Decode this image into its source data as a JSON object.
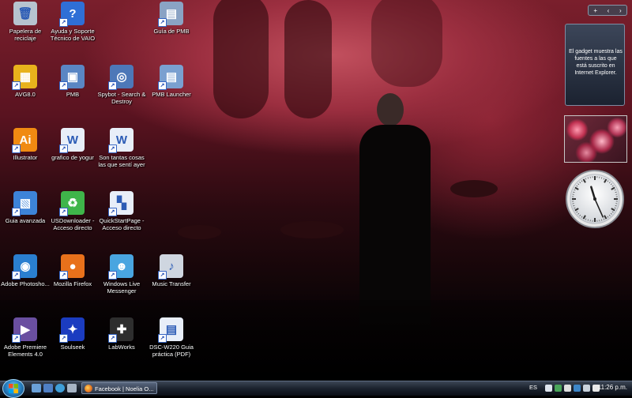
{
  "desktop": {
    "icons": [
      {
        "label": "Papelera de reciclaje",
        "icon": "recycle-bin-icon",
        "color": "#b7c3cf",
        "glyph": "🗑"
      },
      {
        "label": "Ayuda y Soporte Técnico de VAIO",
        "icon": "help-icon",
        "color": "#2f6fd6",
        "glyph": "?"
      },
      {
        "label": "Guía de PMB",
        "icon": "pmb-guide-icon",
        "color": "#8aa3c4",
        "glyph": "▤"
      },
      {
        "label": "AVG8.0",
        "icon": "avg-icon",
        "color": "#e8b21c",
        "glyph": "▦"
      },
      {
        "label": "PMB",
        "icon": "pmb-icon",
        "color": "#5a86c4",
        "glyph": "▣"
      },
      {
        "label": "Spybot - Search & Destroy",
        "icon": "spybot-icon",
        "color": "#4d78b8",
        "glyph": "◎"
      },
      {
        "label": "PMB Launcher",
        "icon": "pmb-launcher-icon",
        "color": "#7aa0d0",
        "glyph": "▤"
      },
      {
        "label": "Illustrator",
        "icon": "illustrator-icon",
        "color": "#f08a12",
        "glyph": "Ai"
      },
      {
        "label": "grafico de yogur",
        "icon": "word-document-icon",
        "color": "#e8eef8",
        "glyph": "W"
      },
      {
        "label": "Son tantas cosas las que sentí ayer",
        "icon": "word-document-icon",
        "color": "#e8eef8",
        "glyph": "W"
      },
      {
        "label": "Guia avanzada",
        "icon": "guide-icon",
        "color": "#3d83d8",
        "glyph": "▧"
      },
      {
        "label": "USDownloader - Acceso directo",
        "icon": "usdownloader-icon",
        "color": "#3fb54a",
        "glyph": "♻"
      },
      {
        "label": "QuickStartPage - Acceso directo",
        "icon": "quickstartpage-icon",
        "color": "#e8eef8",
        "glyph": "▚"
      },
      {
        "label": "Adobe Photosho...",
        "icon": "photoshop-icon",
        "color": "#2a7fd0",
        "glyph": "◉"
      },
      {
        "label": "Mozilla Firefox",
        "icon": "firefox-icon",
        "color": "#e8711b",
        "glyph": "●"
      },
      {
        "label": "Windows Live Messenger",
        "icon": "messenger-icon",
        "color": "#49a5e0",
        "glyph": "☻"
      },
      {
        "label": "Music Transfer",
        "icon": "music-transfer-icon",
        "color": "#cfd6e0",
        "glyph": "♪"
      },
      {
        "label": "Adobe Premiere Elements 4.0",
        "icon": "premiere-icon",
        "color": "#6a4fa0",
        "glyph": "▶"
      },
      {
        "label": "Soulseek",
        "icon": "soulseek-icon",
        "color": "#1b3cc0",
        "glyph": "✦"
      },
      {
        "label": "LabWorks",
        "icon": "labworks-icon",
        "color": "#2e2e2e",
        "glyph": "✚"
      },
      {
        "label": "DSC-W220 Guia práctica (PDF)",
        "icon": "pdf-document-icon",
        "color": "#e8eef8",
        "glyph": "▤"
      }
    ]
  },
  "sidebar": {
    "controls": [
      "+",
      "‹",
      "›"
    ],
    "feed_gadget_text": "El gadget muestra las fuentes a las que está suscrito en Internet Explorer.",
    "clock": {
      "hour": 11,
      "minute": 26
    }
  },
  "taskbar": {
    "start_icon": "windows-start-icon",
    "task_label": "Facebook | Noelia O...",
    "language": "ES",
    "time": "11:26 p.m."
  },
  "colors": {
    "taskbar": "#1b222d",
    "accent": "#3a86c8"
  }
}
